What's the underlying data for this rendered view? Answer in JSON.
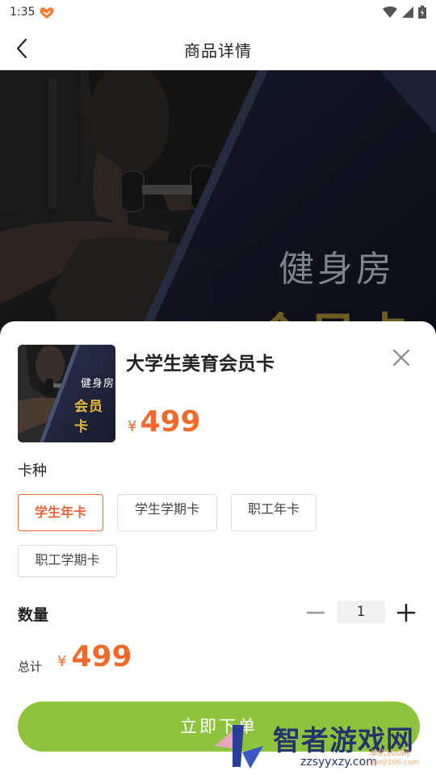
{
  "status_bar": {
    "time": "1:35",
    "icons": [
      "app-notification-icon",
      "wifi-icon",
      "signal-icon",
      "battery-icon"
    ]
  },
  "header": {
    "title": "商品详情",
    "back_icon": "chevron-left-icon"
  },
  "hero": {
    "line1": "健身房",
    "line2": "会员卡"
  },
  "product": {
    "thumbnail_line1": "健身房",
    "thumbnail_line2": "会员卡",
    "name": "大学生美育会员卡",
    "currency": "¥",
    "price": "499",
    "close_icon": "close-icon"
  },
  "card_type": {
    "label": "卡种",
    "options": [
      "学生年卡",
      "学生学期卡",
      "职工年卡",
      "职工学期卡"
    ],
    "selected": "学生年卡"
  },
  "quantity": {
    "label": "数量",
    "value": "1",
    "minus_icon": "minus-icon",
    "plus_icon": "plus-icon"
  },
  "total": {
    "label": "总计",
    "currency": "¥",
    "amount": "499"
  },
  "order_button": {
    "label": "立即下单"
  },
  "watermark": {
    "brand": "智者游戏网",
    "url": "zzsyyxzy.com",
    "badge_line1": "单机100网",
    "badge_line2": "danji100.com"
  },
  "colors": {
    "accent_price": "#f06a2c",
    "selected_chip": "#e46638",
    "order_button": "#8ec43d",
    "watermark_text": "#27356b"
  }
}
